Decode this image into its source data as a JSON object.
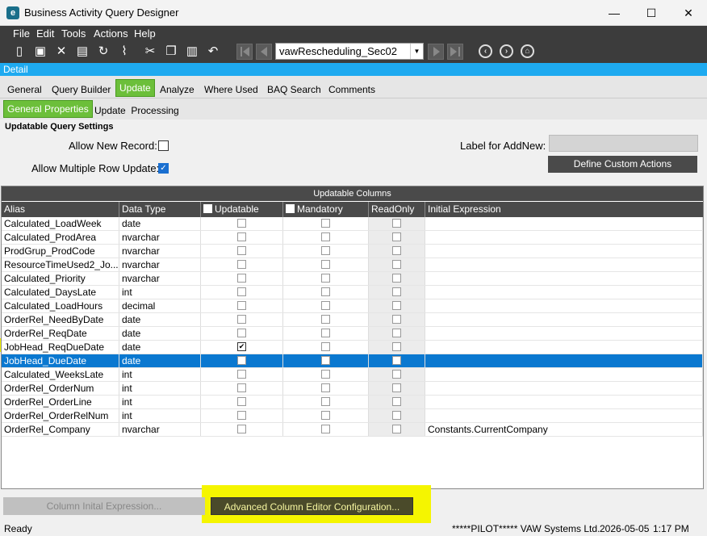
{
  "window": {
    "title": "Business Activity Query Designer",
    "app_icon": "e",
    "minimize": "—",
    "maximize": "☐",
    "close": "✕"
  },
  "menu": [
    "File",
    "Edit",
    "Tools",
    "Actions",
    "Help"
  ],
  "toolbar": {
    "query_id": "vawRescheduling_Sec02"
  },
  "detail_label": "Detail",
  "tabs": [
    "General",
    "Query Builder",
    "Update",
    "Analyze",
    "Where Used",
    "BAQ Search",
    "Comments"
  ],
  "active_tab": "Update",
  "subtabs": [
    "General Properties",
    "Update  Processing"
  ],
  "settings": {
    "title": "Updatable Query Settings",
    "allow_new_record_label": "Allow New Record:",
    "allow_new_record": false,
    "allow_multi_label": "Allow Multiple Row Update:",
    "allow_multi": true,
    "addnew_label": "Label for AddNew:",
    "addnew_value": "",
    "custom_actions_button": "Define Custom Actions"
  },
  "grid": {
    "caption": "Updatable Columns",
    "headers": [
      "Alias",
      "Data Type",
      "Updatable",
      "Mandatory",
      "ReadOnly",
      "Initial Expression"
    ],
    "rows": [
      {
        "alias": "Calculated_LoadWeek",
        "type": "date",
        "upd": false,
        "expr": ""
      },
      {
        "alias": "Calculated_ProdArea",
        "type": "nvarchar",
        "upd": false,
        "expr": ""
      },
      {
        "alias": "ProdGrup_ProdCode",
        "type": "nvarchar",
        "upd": false,
        "expr": ""
      },
      {
        "alias": "ResourceTimeUsed2_Jo...",
        "type": "nvarchar",
        "upd": false,
        "expr": ""
      },
      {
        "alias": "Calculated_Priority",
        "type": "nvarchar",
        "upd": false,
        "expr": ""
      },
      {
        "alias": "Calculated_DaysLate",
        "type": "int",
        "upd": false,
        "expr": ""
      },
      {
        "alias": "Calculated_LoadHours",
        "type": "decimal",
        "upd": false,
        "expr": ""
      },
      {
        "alias": "OrderRel_NeedByDate",
        "type": "date",
        "upd": false,
        "expr": ""
      },
      {
        "alias": "OrderRel_ReqDate",
        "type": "date",
        "upd": false,
        "expr": ""
      },
      {
        "alias": "JobHead_ReqDueDate",
        "type": "date",
        "upd": true,
        "expr": ""
      },
      {
        "alias": "JobHead_DueDate",
        "type": "date",
        "upd": false,
        "expr": ""
      },
      {
        "alias": "Calculated_WeeksLate",
        "type": "int",
        "upd": false,
        "expr": ""
      },
      {
        "alias": "OrderRel_OrderNum",
        "type": "int",
        "upd": false,
        "expr": ""
      },
      {
        "alias": "OrderRel_OrderLine",
        "type": "int",
        "upd": false,
        "expr": ""
      },
      {
        "alias": "OrderRel_OrderRelNum",
        "type": "int",
        "upd": false,
        "expr": ""
      },
      {
        "alias": "OrderRel_Company",
        "type": "nvarchar",
        "upd": false,
        "expr": "Constants.CurrentCompany"
      }
    ]
  },
  "buttons": {
    "init_expr": "Column Inital Expression...",
    "advanced": "Advanced Column Editor Configuration..."
  },
  "status": {
    "text": "Ready",
    "company": "*****PILOT***** VAW Systems Ltd.",
    "date": "2026-05-05",
    "time": "1:17 PM"
  },
  "colors": {
    "accent": "#1eaaf0",
    "tab_active": "#6cbf3a",
    "highlight": "#f5f500",
    "selection": "#0a78d0"
  }
}
